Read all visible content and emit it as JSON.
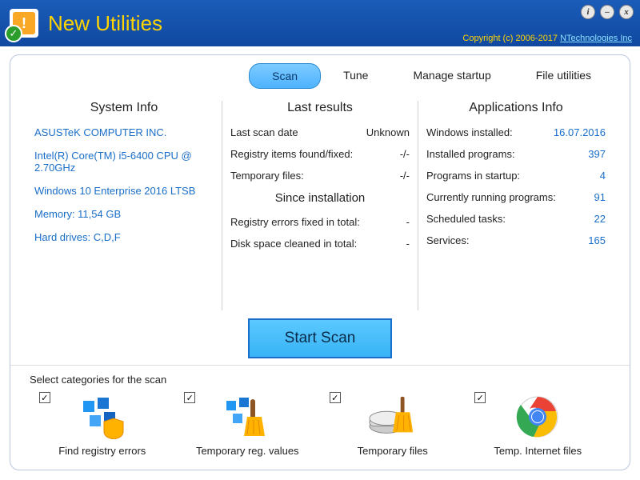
{
  "app": {
    "title": "New Utilities"
  },
  "copyright": {
    "text": "Copyright (c) 2006-2017",
    "link": "NTechnologies Inc"
  },
  "winbtn": {
    "info": "i",
    "min": "–",
    "close": "x"
  },
  "tabs": {
    "scan": "Scan",
    "tune": "Tune",
    "startup": "Manage startup",
    "files": "File utilities"
  },
  "sysinfo": {
    "heading": "System Info",
    "vendor": "ASUSTeK COMPUTER INC.",
    "cpu": "Intel(R) Core(TM) i5-6400 CPU @ 2.70GHz",
    "os": "Windows 10 Enterprise 2016 LTSB",
    "memory": "Memory: 11,54 GB",
    "drives": "Hard drives: C,D,F"
  },
  "lastresults": {
    "heading": "Last results",
    "lastscan_l": "Last scan date",
    "lastscan_v": "Unknown",
    "reg_l": "Registry items found/fixed:",
    "reg_v": "-/-",
    "temp_l": "Temporary files:",
    "temp_v": "-/-",
    "since_h": "Since installation",
    "regfix_l": "Registry errors fixed in total:",
    "regfix_v": "-",
    "disk_l": "Disk space cleaned in total:",
    "disk_v": "-"
  },
  "appsinfo": {
    "heading": "Applications Info",
    "win_l": "Windows installed:",
    "win_v": "16.07.2016",
    "prog_l": "Installed programs:",
    "prog_v": "397",
    "startup_l": "Programs in startup:",
    "startup_v": "4",
    "run_l": "Currently running programs:",
    "run_v": "91",
    "sched_l": "Scheduled tasks:",
    "sched_v": "22",
    "svc_l": "Services:",
    "svc_v": "165"
  },
  "start_scan": "Start Scan",
  "categories": {
    "label": "Select categories for the scan",
    "c1": "Find registry errors",
    "c2": "Temporary reg. values",
    "c3": "Temporary files",
    "c4": "Temp. Internet files",
    "check": "☑"
  }
}
